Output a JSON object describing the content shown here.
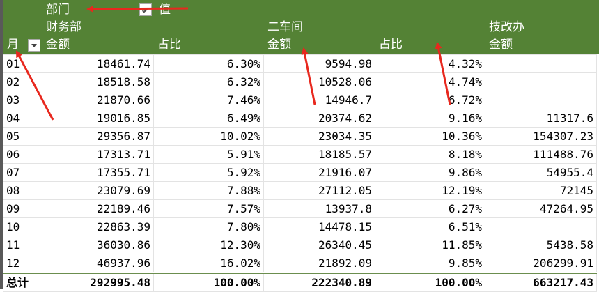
{
  "pivot": {
    "row_filter_label": "部门",
    "values_label": "值",
    "row_field_label": "月",
    "departments": [
      "财务部",
      "二车间",
      "技改办"
    ],
    "col_labels": [
      "金额",
      "占比",
      "金额",
      "占比",
      "金额"
    ],
    "rows": [
      {
        "month": "01",
        "v": [
          "18461.74",
          "6.30%",
          "9594.98",
          "4.32%",
          ""
        ]
      },
      {
        "month": "02",
        "v": [
          "18518.58",
          "6.32%",
          "10528.06",
          "4.74%",
          ""
        ]
      },
      {
        "month": "03",
        "v": [
          "21870.66",
          "7.46%",
          "14946.7",
          "6.72%",
          ""
        ]
      },
      {
        "month": "04",
        "v": [
          "19016.85",
          "6.49%",
          "20374.62",
          "9.16%",
          "11317.6"
        ]
      },
      {
        "month": "05",
        "v": [
          "29356.87",
          "10.02%",
          "23034.35",
          "10.36%",
          "154307.23"
        ]
      },
      {
        "month": "06",
        "v": [
          "17313.71",
          "5.91%",
          "18185.57",
          "8.18%",
          "111488.76"
        ]
      },
      {
        "month": "07",
        "v": [
          "17355.71",
          "5.92%",
          "21916.07",
          "9.86%",
          "54955.4"
        ]
      },
      {
        "month": "08",
        "v": [
          "23079.69",
          "7.88%",
          "27112.05",
          "12.19%",
          "72145"
        ]
      },
      {
        "month": "09",
        "v": [
          "22189.46",
          "7.57%",
          "13937.8",
          "6.27%",
          "47264.95"
        ]
      },
      {
        "month": "10",
        "v": [
          "22863.39",
          "7.80%",
          "14478.15",
          "6.51%",
          ""
        ]
      },
      {
        "month": "11",
        "v": [
          "36030.86",
          "12.30%",
          "26340.45",
          "11.85%",
          "5438.58"
        ]
      },
      {
        "month": "12",
        "v": [
          "46937.96",
          "16.02%",
          "21892.09",
          "9.85%",
          "206299.91"
        ]
      }
    ],
    "total": {
      "label": "总计",
      "v": [
        "292995.48",
        "100.00%",
        "222340.89",
        "100.00%",
        "663217.43"
      ]
    }
  },
  "colors": {
    "header_green": "#548235",
    "annotation_red": "#e8281e"
  }
}
